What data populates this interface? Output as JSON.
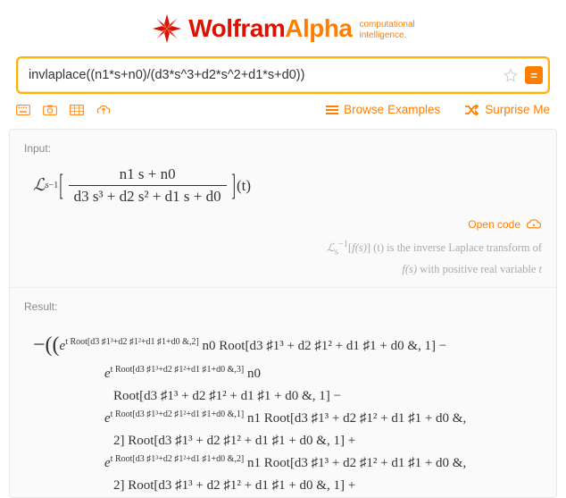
{
  "header": {
    "wolfram": "Wolfram",
    "alpha": "Alpha",
    "tagline1": "computational",
    "tagline2": "intelligence.",
    "tm": "™"
  },
  "search": {
    "value": "invlaplace((n1*s+n0)/(d3*s^3+d2*s^2+d1*s+d0))",
    "equals": "="
  },
  "toolbar": {
    "browse": "Browse Examples",
    "surprise": "Surprise Me"
  },
  "sections": {
    "input_label": "Input:",
    "result_label": "Result:",
    "open_code": "Open code"
  },
  "input_math": {
    "L": "ℒ",
    "inv": "−1",
    "sub": "s",
    "num": "n1 s + n0",
    "den": "d3 s³ + d2 s² + d1 s + d0",
    "arg": "(t)"
  },
  "hint": {
    "prefix": "ℒ",
    "sup": "−1",
    "sub": "s",
    "mid1": "[",
    "fs": "f(s)",
    "mid2": "] (t)",
    "text1": " is the inverse Laplace transform of",
    "line2_fs": "f(s)",
    "line2_rest": " with positive real variable ",
    "line2_t": "t"
  },
  "result": {
    "l1_a": "−((e",
    "l1_exp": "t Root[d3 ♯1³+d2 ♯1²+d1 ♯1+d0 &,2]",
    "l1_b": " n0 Root[d3 ♯1³ + d2 ♯1² + d1 ♯1 + d0 &, 1] −",
    "l2_a": "e",
    "l2_exp": "t Root[d3 ♯1³+d2 ♯1²+d1 ♯1+d0 &,3]",
    "l2_b": " n0",
    "l3": "Root[d3 ♯1³ + d2 ♯1² + d1 ♯1 + d0 &, 1] −",
    "l4_a": "e",
    "l4_exp": "t Root[d3 ♯1³+d2 ♯1²+d1 ♯1+d0 &,1]",
    "l4_b": " n1 Root[d3 ♯1³ + d2 ♯1² + d1 ♯1 + d0 &,",
    "l5": "2] Root[d3 ♯1³ + d2 ♯1² + d1 ♯1 + d0 &, 1] +",
    "l6_a": "e",
    "l6_exp": "t Root[d3 ♯1³+d2 ♯1²+d1 ♯1+d0 &,2]",
    "l6_b": " n1 Root[d3 ♯1³ + d2 ♯1² + d1 ♯1 + d0 &,",
    "l7": "2] Root[d3 ♯1³ + d2 ♯1² + d1 ♯1 + d0 &, 1] +"
  }
}
